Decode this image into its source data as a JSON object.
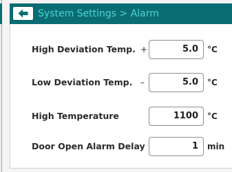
{
  "header": {
    "title": "System Settings > Alarm",
    "back_icon": "arrow-left-icon"
  },
  "colors": {
    "header_bg": "#0a6d74",
    "header_text": "#4fd4d1",
    "panel_bg": "#ffffff",
    "field_border": "#8e8e8e"
  },
  "settings": [
    {
      "label": "High Deviation Temp.",
      "sign": "+",
      "value": "5.0",
      "unit": "°C"
    },
    {
      "label": "Low Deviation Temp.",
      "sign": "–",
      "value": "5.0",
      "unit": "°C"
    },
    {
      "label": "High Temperature",
      "sign": "",
      "value": "1100",
      "unit": "°C"
    },
    {
      "label": "Door Open Alarm Delay",
      "sign": "",
      "value": "1",
      "unit": "min"
    }
  ]
}
